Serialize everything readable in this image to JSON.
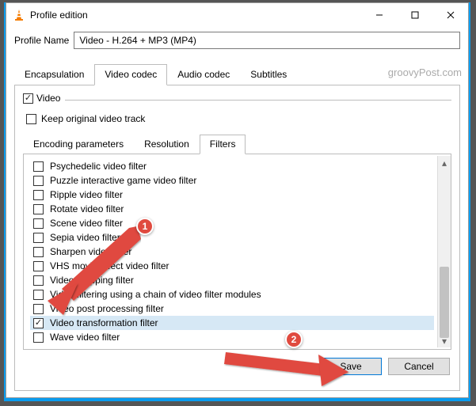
{
  "window": {
    "title": "Profile edition"
  },
  "profile": {
    "label": "Profile Name",
    "value": "Video - H.264 + MP3 (MP4)"
  },
  "tabs": [
    "Encapsulation",
    "Video codec",
    "Audio codec",
    "Subtitles"
  ],
  "active_tab": 1,
  "video_group": {
    "label": "Video",
    "checked": true,
    "keep_original_label": "Keep original video track",
    "keep_original_checked": false
  },
  "subtabs": [
    "Encoding parameters",
    "Resolution",
    "Filters"
  ],
  "active_subtab": 2,
  "filters": [
    {
      "label": "Psychedelic video filter",
      "checked": false
    },
    {
      "label": "Puzzle interactive game video filter",
      "checked": false
    },
    {
      "label": "Ripple video filter",
      "checked": false
    },
    {
      "label": "Rotate video filter",
      "checked": false
    },
    {
      "label": "Scene video filter",
      "checked": false
    },
    {
      "label": "Sepia video filter",
      "checked": false
    },
    {
      "label": "Sharpen video filter",
      "checked": false
    },
    {
      "label": "VHS movie effect video filter",
      "checked": false
    },
    {
      "label": "Video cropping filter",
      "checked": false
    },
    {
      "label": "Video filtering using a chain of video filter modules",
      "checked": false
    },
    {
      "label": "Video post processing filter",
      "checked": false
    },
    {
      "label": "Video transformation filter",
      "checked": true,
      "selected": true
    },
    {
      "label": "Wave video filter",
      "checked": false
    }
  ],
  "buttons": {
    "save": "Save",
    "cancel": "Cancel"
  },
  "watermark": "groovyPost.com",
  "callouts": {
    "one": "1",
    "two": "2"
  }
}
